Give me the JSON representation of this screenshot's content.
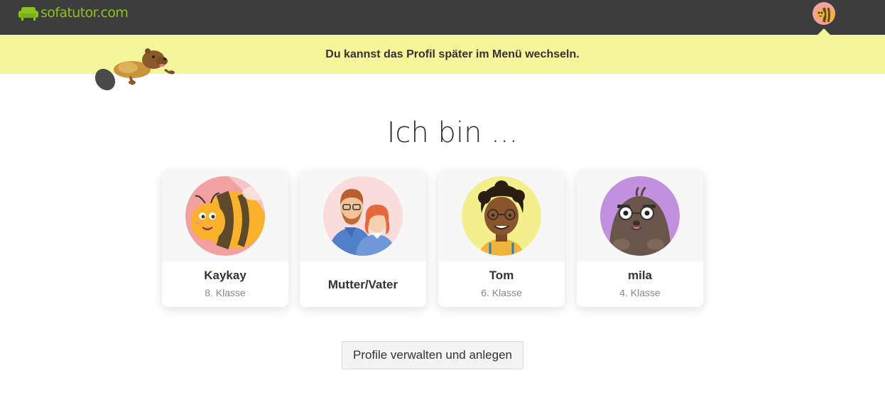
{
  "header": {
    "logo_text": "sofatutor.com",
    "logo_color": "#8cc21d",
    "background": "#3d3d3d",
    "account_avatar_icon": "bee-avatar-icon"
  },
  "banner": {
    "text": "Du kannst das Profil später im Menü wechseln.",
    "background": "#f5f59a",
    "mascot_icon": "beaver-mascot"
  },
  "headline": "Ich bin ...",
  "profiles": [
    {
      "name": "Kaykay",
      "grade": "8. Klasse",
      "avatar": "bee-avatar-icon"
    },
    {
      "name": "Mutter/Vater",
      "grade": "",
      "avatar": "parents-avatar-icon"
    },
    {
      "name": "Tom",
      "grade": "6. Klasse",
      "avatar": "boy-avatar-icon"
    },
    {
      "name": "mila",
      "grade": "4. Klasse",
      "avatar": "mole-avatar-icon"
    }
  ],
  "manage_button_label": "Profile verwalten und anlegen"
}
